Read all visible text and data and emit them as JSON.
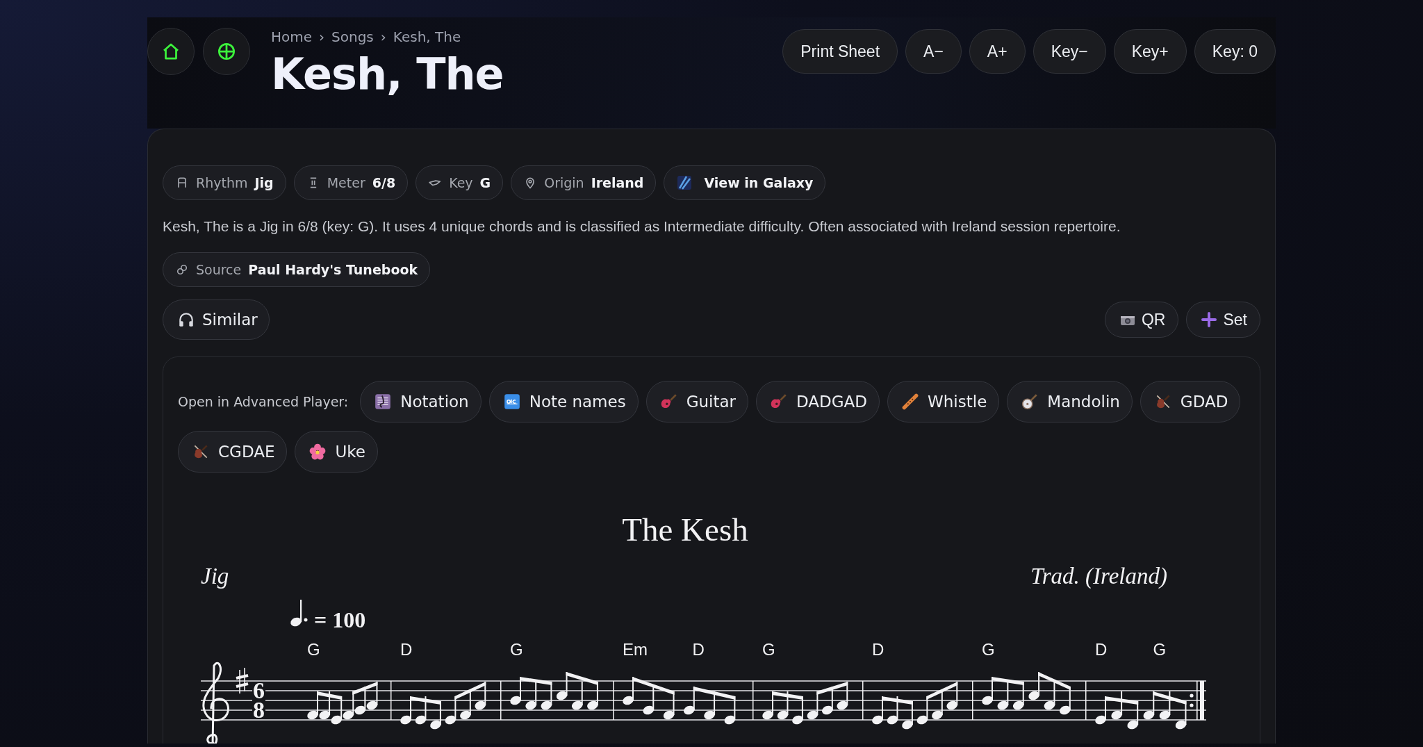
{
  "header": {
    "breadcrumb": [
      "Home",
      "Songs",
      "Kesh, The"
    ],
    "breadcrumb_separators": [
      "›",
      "›"
    ],
    "title": "Kesh, The",
    "toolbar": [
      "Print Sheet",
      "A−",
      "A+",
      "Key−",
      "Key+",
      "Key: 0"
    ]
  },
  "details": {
    "meta": [
      {
        "kind": "fact",
        "label": "Rhythm",
        "value": "Jig"
      },
      {
        "kind": "fact",
        "label": "Meter",
        "value": "6/8"
      },
      {
        "kind": "fact",
        "label": "Key",
        "value": "G"
      },
      {
        "kind": "fact",
        "label": "Origin",
        "value": "Ireland"
      },
      {
        "kind": "link",
        "value": "View in Galaxy"
      }
    ],
    "description": "Kesh, The is a Jig in 6/8 (key: G). It uses 4 unique chords and is classified as Intermediate difficulty. Often associated with Ireland session repertoire.",
    "source": {
      "label": "Source",
      "value": "Paul Hardy's Tunebook"
    },
    "similar_button": "Similar",
    "actions": [
      "QR",
      "Set"
    ]
  },
  "player": {
    "label": "Open in Advanced Player:",
    "options": [
      "Notation",
      "Note names",
      "Guitar",
      "DADGAD",
      "Whistle",
      "Mandolin",
      "GDAD",
      "CGDAE",
      "Uke"
    ]
  },
  "sheet": {
    "title": "The Kesh",
    "rhythm": "Jig",
    "composer": "Trad. (Ireland)",
    "tempo": "= 100",
    "time_signature": [
      "6",
      "8"
    ],
    "measures": [
      {
        "chords": [
          "G"
        ]
      },
      {
        "chords": [
          "D"
        ]
      },
      {
        "chords": [
          "G"
        ]
      },
      {
        "chords": [
          "Em",
          "D"
        ]
      },
      {
        "chords": [
          "G"
        ]
      },
      {
        "chords": [
          "D"
        ]
      },
      {
        "chords": [
          "G"
        ]
      },
      {
        "chords": [
          "D",
          "G"
        ]
      }
    ]
  }
}
